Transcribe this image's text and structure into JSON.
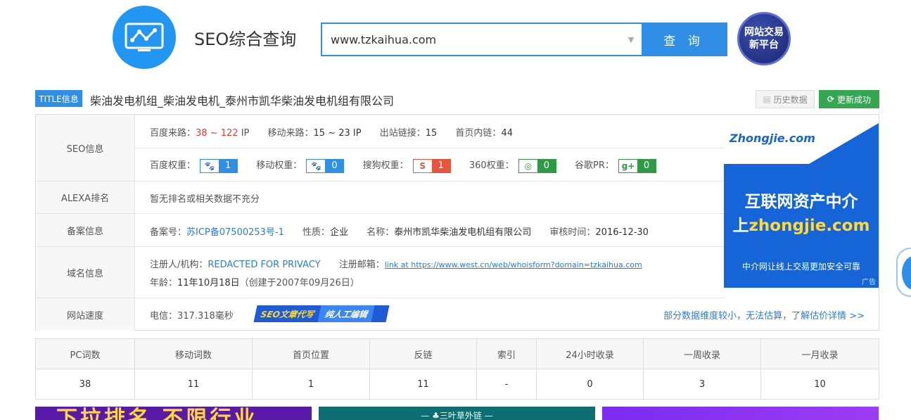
{
  "header": {
    "app_title": "SEO综合查询",
    "search_value": "www.tzkaihua.com",
    "search_button": "查 询",
    "badge_line1": "网站交易",
    "badge_line2": "新平台"
  },
  "title_bar": {
    "tag": "TITLE信息",
    "text": "柴油发电机组_柴油发电机_泰州市凯华柴油发电机组有限公司",
    "history_button": "历史数据",
    "update_button": "更新成功"
  },
  "seo": {
    "label": "SEO信息",
    "baidu_traffic_label": "百度来路：",
    "baidu_traffic_low": "38",
    "baidu_traffic_sep": " ~ ",
    "baidu_traffic_high": "122",
    "baidu_traffic_unit": " IP",
    "mobile_traffic_label": "移动来路：",
    "mobile_traffic": "15 ~ 23 IP",
    "outlinks_label": "出站链接：",
    "outlinks": "15",
    "inlinks_label": "首页内链：",
    "inlinks": "44",
    "baidu_weight_label": "百度权重：",
    "baidu_weight": "1",
    "mobile_weight_label": "移动权重：",
    "mobile_weight": "0",
    "sogou_weight_label": "搜狗权重：",
    "sogou_weight": "1",
    "weight_360_label": "360权重：",
    "weight_360": "0",
    "google_pr_label": "谷歌PR：",
    "google_pr": "0"
  },
  "alexa": {
    "label": "ALEXA排名",
    "text": "暂无排名或相关数据不充分"
  },
  "icp": {
    "label": "备案信息",
    "num_label": "备案号：",
    "num": "苏ICP备07500253号-1",
    "type_label": "性质：",
    "type": "企业",
    "name_label": "名称：",
    "name": "泰州市凯华柴油发电机组有限公司",
    "date_label": "审核时间：",
    "date": "2016-12-30"
  },
  "domain": {
    "label": "域名信息",
    "registrant_label": "注册人/机构：",
    "registrant": "REDACTED FOR PRIVACY",
    "email_label": "注册邮箱：",
    "email": "link at https://www.west.cn/web/whoisform?domain=tzkaihua.com",
    "age_label": "年龄：",
    "age": "11年10月18日",
    "created": "（创建于2007年09月26日）"
  },
  "speed": {
    "label": "网站速度",
    "text": "电信：317.318毫秒",
    "ad_part1": "SEO文章代写",
    "ad_part2": "纯人工编辑",
    "link": "部分数据维度较小，无法估算，了解估价详情 >>"
  },
  "right_ad": {
    "brand": "Zhongjie.com",
    "line1": "互联网资产中介",
    "line2_prefix": "上",
    "line2_domain": "zhongjie.com",
    "line3": "中介网让线上交易更加安全可靠",
    "ad_tag": "广告"
  },
  "stats": {
    "headers": [
      "PC词数",
      "移动词数",
      "首页位置",
      "反链",
      "索引",
      "24小时收录",
      "一周收录",
      "一月收录"
    ],
    "values": [
      "38",
      "11",
      "1",
      "11",
      "-",
      "0",
      "3",
      "10"
    ]
  },
  "bottom": {
    "banner1": "下拉排名 不限行业",
    "banner2": "三叶草外链"
  },
  "colors": {
    "primary": "#2f8fe6",
    "green": "#33a850",
    "red": "#e53935"
  }
}
